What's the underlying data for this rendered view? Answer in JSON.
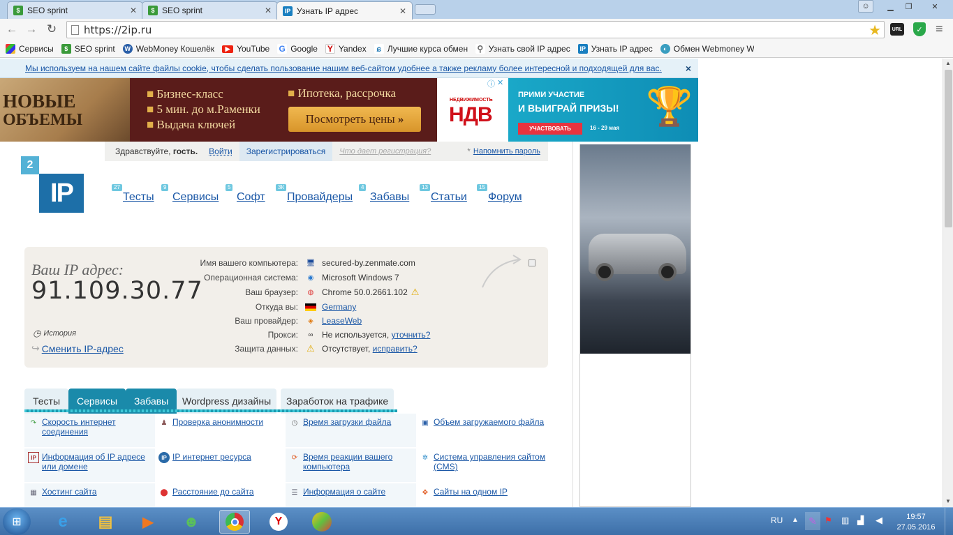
{
  "browser": {
    "tabs": [
      {
        "label": "SEO sprint",
        "icon": "seosprint-icon"
      },
      {
        "label": "SEO sprint",
        "icon": "seosprint-icon"
      },
      {
        "label": "Узнать IP адрес",
        "icon": "2ip-icon"
      }
    ],
    "url": "https://2ip.ru",
    "bookmarks": [
      {
        "label": "Сервисы",
        "icon": "apps-icon"
      },
      {
        "label": "SEO sprint",
        "icon": "seosprint-icon"
      },
      {
        "label": "WebMoney Кошелёк",
        "icon": "webmoney-icon"
      },
      {
        "label": "YouTube",
        "icon": "youtube-icon"
      },
      {
        "label": "Google",
        "icon": "google-icon"
      },
      {
        "label": "Yandex",
        "icon": "yandex-icon"
      },
      {
        "label": "Лучшие курса обмен",
        "icon": "exchange-icon"
      },
      {
        "label": "Узнать свой IP адрес",
        "icon": "search-icon"
      },
      {
        "label": "Узнать IP адрес",
        "icon": "2ip-icon"
      },
      {
        "label": "Обмен Webmoney W",
        "icon": "exchange-icon"
      }
    ],
    "extensions": {
      "url_badge": "URL"
    }
  },
  "cookie_notice": {
    "text": "Мы используем на нашем сайте файлы cookie, чтобы сделать пользование нашим веб-сайтом удобнее а также рекламу более интересной и подходящей для вас.",
    "close": "×"
  },
  "banner": {
    "headline_1": "НОВЫЕ",
    "headline_2": "ОБЪЕМЫ",
    "bullets_left": [
      "Бизнес-класс",
      "5 мин. до м.Раменки",
      "Выдача ключей"
    ],
    "bullet_right": "Ипотека, рассрочка",
    "cta": "Посмотреть цены",
    "cta_arrows": "»",
    "logo_top": "НЕДВИЖИМОСТЬ",
    "logo_main": "НДВ",
    "promo_1": "ПРИМИ УЧАСТИЕ",
    "promo_2": "И ВЫИГРАЙ ПРИЗЫ!",
    "promo_btn": "УЧАСТВОВАТЬ",
    "promo_dates": "16 - 29 мая"
  },
  "login": {
    "greeting": "Здравствуйте,",
    "guest": "гость.",
    "login": "Войти",
    "register": "Зарегистрироваться",
    "why": "Что дает регистрация?",
    "star": "*",
    "remind": "Напомнить пароль"
  },
  "logo": {
    "badge": "2",
    "text": "IP"
  },
  "nav": [
    {
      "label": "Тесты",
      "count": "27"
    },
    {
      "label": "Сервисы",
      "count": "9"
    },
    {
      "label": "Софт",
      "count": "5"
    },
    {
      "label": "Провайдеры",
      "count": "3К"
    },
    {
      "label": "Забавы",
      "count": "4"
    },
    {
      "label": "Статьи",
      "count": "13"
    },
    {
      "label": "Форум",
      "count": "15"
    }
  ],
  "ip": {
    "heading": "Ваш IP адрес:",
    "address": "91.109.30.77",
    "history": "История",
    "change": "Сменить IP-адрес",
    "rows": [
      {
        "label": "Имя вашего компьютера:",
        "value": "secured-by.zenmate.com",
        "link": "",
        "icon": "computer-icon"
      },
      {
        "label": "Операционная система:",
        "value": "Microsoft Windows 7",
        "link": "",
        "icon": "windows-icon"
      },
      {
        "label": "Ваш браузер:",
        "value": "Chrome 50.0.2661.102",
        "link": "",
        "icon": "chrome-icon"
      },
      {
        "label": "Откуда вы:",
        "value": "",
        "link": "Germany",
        "icon": "flag-icon"
      },
      {
        "label": "Ваш провайдер:",
        "value": "",
        "link": "LeaseWeb",
        "icon": "provider-icon"
      },
      {
        "label": "Прокси:",
        "value": "Не используется,",
        "link": "уточнить?",
        "icon": "glasses-icon"
      },
      {
        "label": "Защита данных:",
        "value": "Отсутствует,",
        "link": "исправить?",
        "icon": "warning-icon"
      }
    ]
  },
  "service_tabs": [
    "Тесты",
    "Сервисы",
    "Забавы",
    "Wordpress дизайны",
    "Заработок на трафике"
  ],
  "services": [
    {
      "label": "Скорость интернет соединения",
      "icon": "speed-icon"
    },
    {
      "label": "Проверка анонимности",
      "icon": "anonymity-icon"
    },
    {
      "label": "Время загрузки файла",
      "icon": "clock-icon"
    },
    {
      "label": "Объем загружаемого файла",
      "icon": "file-size-icon"
    },
    {
      "label": "Информация об IP адресе или домене",
      "icon": "ip-info-icon"
    },
    {
      "label": "IP интернет ресурса",
      "icon": "ip-resource-icon"
    },
    {
      "label": "Время реакции вашего компьютера",
      "icon": "reaction-icon"
    },
    {
      "label": "Система управления сайтом (CMS)",
      "icon": "cms-icon"
    },
    {
      "label": "Хостинг сайта",
      "icon": "hosting-icon"
    },
    {
      "label": "Расстояние до сайта",
      "icon": "pin-icon"
    },
    {
      "label": "Информация о сайте",
      "icon": "site-info-icon"
    },
    {
      "label": "Сайты на одном IP",
      "icon": "sites-ip-icon"
    }
  ],
  "taskbar": {
    "lang": "RU",
    "time": "19:57",
    "date": "27.05.2016"
  }
}
